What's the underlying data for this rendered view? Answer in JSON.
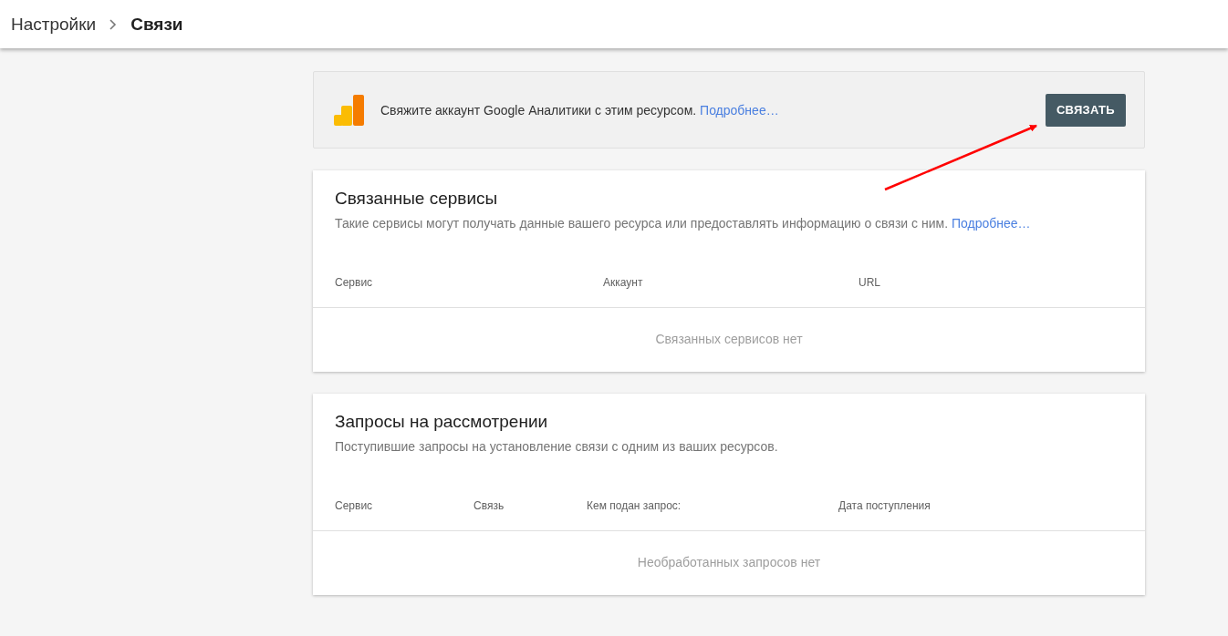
{
  "breadcrumb": [
    {
      "label": "Настройки",
      "current": false
    },
    {
      "label": "Связи",
      "current": true
    }
  ],
  "banner": {
    "text": "Свяжите аккаунт Google Аналитики с этим ресурсом.",
    "link": "Подробнее…",
    "button": "СВЯЗАТЬ"
  },
  "cards": [
    {
      "title": "Связанные сервисы",
      "description": "Такие сервисы могут получать данные вашего ресурса или предоставлять информацию о связи с ним.",
      "link": "Подробнее…",
      "columns": [
        "Сервис",
        "Аккаунт",
        "URL"
      ],
      "empty": "Связанных сервисов нет"
    },
    {
      "title": "Запросы на рассмотрении",
      "description": "Поступившие запросы на установление связи с одним из ваших ресурсов.",
      "columns": [
        "Сервис",
        "Связь",
        "Кем подан запрос:",
        "Дата поступления"
      ],
      "empty": "Необработанных запросов нет"
    }
  ]
}
